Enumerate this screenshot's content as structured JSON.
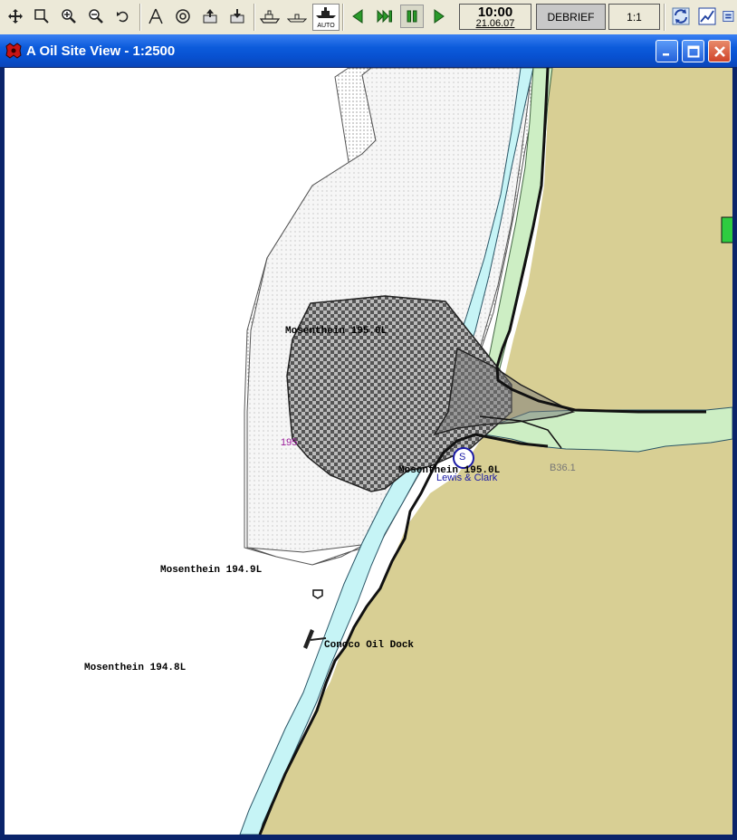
{
  "toolbar": {
    "buttons": [
      {
        "name": "move",
        "icon": "move-arrows-icon"
      },
      {
        "name": "zoom-window",
        "icon": "zoom-window-icon"
      },
      {
        "name": "zoom-in",
        "icon": "zoom-in-icon"
      },
      {
        "name": "zoom-out",
        "icon": "zoom-out-icon"
      },
      {
        "name": "undo-view",
        "icon": "undo-icon"
      },
      {
        "name": "compass",
        "icon": "compass-icon"
      },
      {
        "name": "target",
        "icon": "target-icon"
      },
      {
        "name": "export",
        "icon": "export-icon"
      },
      {
        "name": "import",
        "icon": "import-icon"
      },
      {
        "name": "ship-view",
        "icon": "ship-icon"
      },
      {
        "name": "ship-outline",
        "icon": "ship-outline-icon"
      }
    ],
    "auto_label": "AUTO",
    "clock_time": "10:00",
    "clock_date": "21.06.07",
    "debrief_label": "DEBRIEF",
    "scale_label": "1:1"
  },
  "window": {
    "title": "A Oil Site View - 1:2500"
  },
  "map": {
    "labels": {
      "mos_195_0l_top": "Mosenthein 195.0L",
      "mos_195_0l_bottom": "Mosenthein 195.0L",
      "mos_194_9l": "Mosenthein 194.9L",
      "mos_194_8l": "Mosenthein 194.8L",
      "oil_dock": "Conoco Oil Dock",
      "vessel": "Lewis & Clark",
      "buoy": "B36.1",
      "partial_depth": "195",
      "station_symbol": "S"
    },
    "colors": {
      "land": "#d8cf94",
      "water_channel": "#c6f4f6",
      "green_zone": "#cdeec4",
      "hatch_fill": "#888888"
    }
  }
}
